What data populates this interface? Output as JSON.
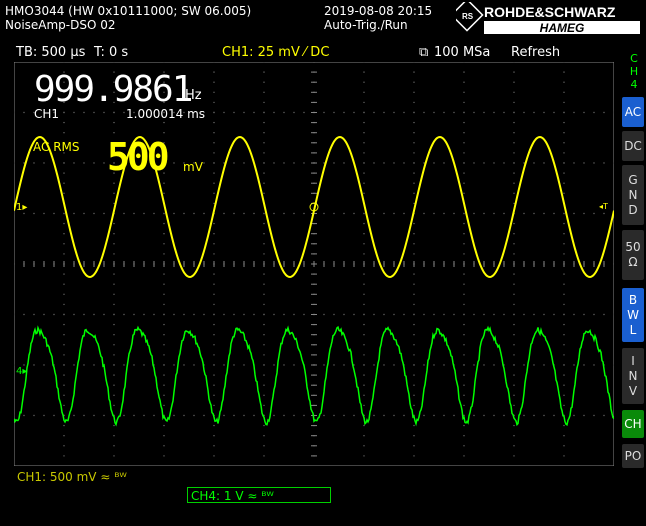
{
  "header": {
    "model_line": "HMO3044 (HW 0x10111000; SW 06.005)",
    "setup_name": "NoiseAmp-DSO 02",
    "datetime": "2019-08-08 20:15",
    "trigger_mode": "Auto-Trig./Run",
    "brand_top": "ROHDE&SCHWARZ",
    "brand_bottom": "HAMEG"
  },
  "status": {
    "timebase": "TB: 500 µs",
    "trigger_time": "T: 0 s",
    "trigger_source": "CH1: 25 mV ⁄ DC",
    "sample_rate": "100 MSa",
    "acq_mode": "Refresh"
  },
  "measurements": {
    "frequency": "999.9861",
    "frequency_unit": "Hz",
    "channel": "CH1",
    "period": "1.000014 ms",
    "rms_label": "AC RMS",
    "rms_value": "500",
    "rms_unit": "mV"
  },
  "side_menu": {
    "title": "CH 4",
    "items": [
      "AC",
      "DC",
      "G N D",
      "50 Ω",
      "B W L",
      "I N V",
      "CH",
      "PO"
    ]
  },
  "footer": {
    "ch1": "CH1: 500 mV ≈ ᴮᵂ",
    "ch4": "CH4: 1 V ≈ ᴮᵂ"
  },
  "colors": {
    "ch1": "#ffff00",
    "ch4": "#00ff00",
    "grid": "#666666",
    "accent": "#1a5fd0"
  },
  "waveforms": {
    "ch1_periods": 6,
    "ch4_periods": 12
  }
}
